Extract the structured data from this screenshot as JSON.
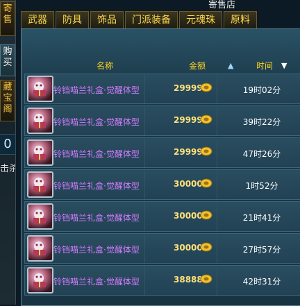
{
  "window": {
    "title": "寄售店"
  },
  "left_panel": {
    "buttons": [
      {
        "label": "寄售"
      },
      {
        "label": "购买"
      },
      {
        "label": "藏宝阁"
      }
    ],
    "number": "0",
    "partial_text": "击杀"
  },
  "tabs": [
    {
      "label": "武器"
    },
    {
      "label": "防具"
    },
    {
      "label": "饰品"
    },
    {
      "label": "门派装备"
    },
    {
      "label": "元魂珠"
    },
    {
      "label": "原料"
    }
  ],
  "table": {
    "headers": {
      "name": "名称",
      "price": "金额",
      "time": "时间"
    },
    "sort": {
      "price_icon": "sort-up-icon",
      "time_icon": "sort-down-icon"
    },
    "rows": [
      {
        "name": "铃铛喵兰礼盒·觉醒体型",
        "price": "29999",
        "time": "19时02分"
      },
      {
        "name": "铃铛喵兰礼盒·觉醒体型",
        "price": "29999",
        "time": "39时22分"
      },
      {
        "name": "铃铛喵兰礼盒·觉醒体型",
        "price": "29999",
        "time": "47时26分"
      },
      {
        "name": "铃铛喵兰礼盒·觉醒体型",
        "price": "30000",
        "time": "1时52分"
      },
      {
        "name": "铃铛喵兰礼盒·觉醒体型",
        "price": "30000",
        "time": "21时41分"
      },
      {
        "name": "铃铛喵兰礼盒·觉醒体型",
        "price": "30000",
        "time": "27时57分"
      },
      {
        "name": "铃铛喵兰礼盒·觉醒体型",
        "price": "38888",
        "time": "42时31分"
      }
    ]
  },
  "colors": {
    "tab_text": "#ffd74a",
    "header_text": "#ffd21e",
    "item_name": "#d37bff",
    "price_text": "#ffe07a",
    "time_text": "#ffffff"
  }
}
